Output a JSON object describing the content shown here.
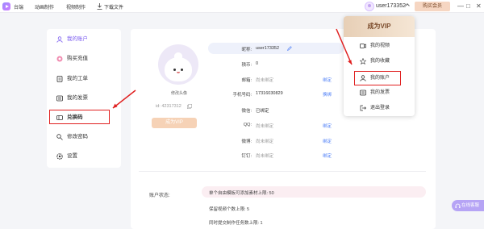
{
  "topbar": {
    "nav": [
      "台端",
      "动画制作",
      "视频制作",
      "下载文件"
    ],
    "username": "user173352",
    "vip_button": "购买会员",
    "controls": [
      "—",
      "□",
      "✕"
    ]
  },
  "sidebar": {
    "items": [
      {
        "label": "我的账户",
        "icon": "user-icon",
        "active": true
      },
      {
        "label": "购买充值",
        "icon": "coin-icon",
        "active": false
      },
      {
        "label": "我的工单",
        "icon": "ticket-icon",
        "active": false
      },
      {
        "label": "我的发票",
        "icon": "invoice-icon",
        "active": false
      },
      {
        "label": "兑换码",
        "icon": "redeem-code-icon",
        "active": false
      },
      {
        "label": "修改密码",
        "icon": "key-icon",
        "active": false
      },
      {
        "label": "设置",
        "icon": "gear-icon",
        "active": false
      }
    ]
  },
  "profile": {
    "change_avatar": "修改头像",
    "uid": "id: 42317312",
    "become_vip": "成为VIP"
  },
  "account_info": {
    "rows": [
      {
        "label": "昵称:",
        "value": "user173352",
        "link": ""
      },
      {
        "label": "積币:",
        "value": "0",
        "link": ""
      },
      {
        "label": "邮箱:",
        "value": "尚未绑定",
        "link": "绑定"
      },
      {
        "label": "手机号码:",
        "value": "17316030829",
        "link": "换绑"
      },
      {
        "label": "微信:",
        "value": "已绑定",
        "link": ""
      },
      {
        "label": "QQ:",
        "value": "尚未绑定",
        "link": "绑定"
      },
      {
        "label": "微博:",
        "value": "尚未绑定",
        "link": "绑定"
      },
      {
        "label": "钉钉:",
        "value": "尚未绑定",
        "link": "绑定"
      }
    ]
  },
  "status": {
    "label": "账户状态:",
    "lines": [
      "单个自由模板可添加素材上限: 50",
      "保留视频个数上限: 5",
      "同时提交制作任务数上限: 1"
    ]
  },
  "dropdown": {
    "header": "成为VIP",
    "items": [
      {
        "label": "我的视频",
        "icon": "video-icon"
      },
      {
        "label": "我的收藏",
        "icon": "star-icon"
      },
      {
        "label": "我的账户",
        "icon": "user-icon"
      },
      {
        "label": "我的发票",
        "icon": "invoice-icon"
      },
      {
        "label": "退出登录",
        "icon": "logout-icon"
      }
    ]
  },
  "online_service": "在线客服",
  "colors": {
    "accent": "#7b5cf0",
    "annotation_red": "#e02020",
    "vip_gold": "#f6d2b6",
    "link_blue": "#4a7cf7"
  }
}
